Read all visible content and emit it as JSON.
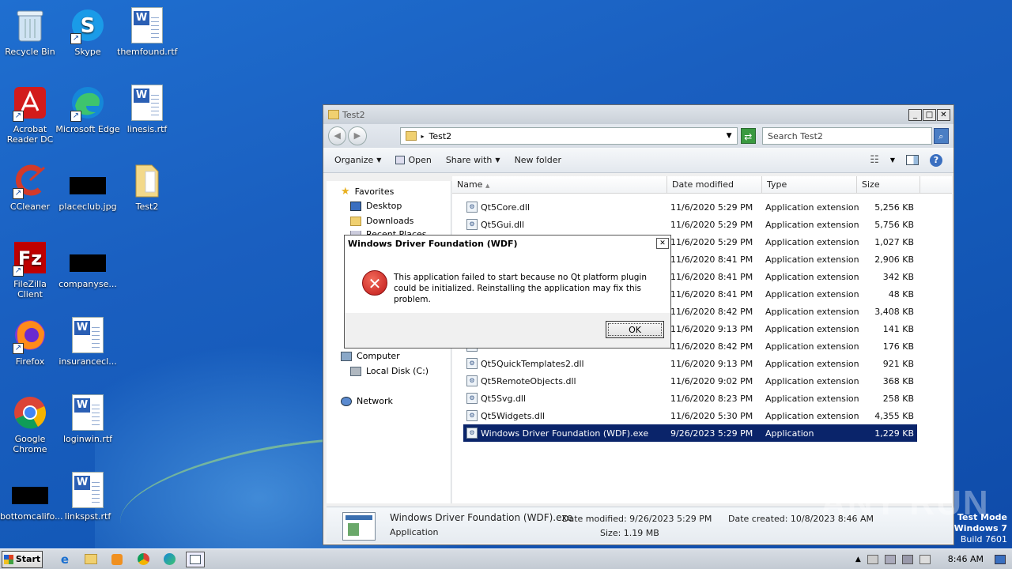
{
  "desktop": {
    "icons": [
      {
        "label": "Recycle Bin"
      },
      {
        "label": "Skype"
      },
      {
        "label": "themfound.rtf"
      },
      {
        "label": "Acrobat Reader DC"
      },
      {
        "label": "Microsoft Edge"
      },
      {
        "label": "linesis.rtf"
      },
      {
        "label": "CCleaner"
      },
      {
        "label": "placeclub.jpg"
      },
      {
        "label": "Test2"
      },
      {
        "label": "FileZilla Client"
      },
      {
        "label": "companyse..."
      },
      {
        "label": "Firefox"
      },
      {
        "label": "insurancecl..."
      },
      {
        "label": "Google Chrome"
      },
      {
        "label": "loginwin.rtf"
      },
      {
        "label": "bottomcalifo..."
      },
      {
        "label": "linkspst.rtf"
      }
    ]
  },
  "explorer": {
    "title": "Test2",
    "address": "Test2",
    "search_placeholder": "Search Test2",
    "commands": {
      "organize": "Organize",
      "open": "Open",
      "share_with": "Share with",
      "new_folder": "New folder"
    },
    "nav": {
      "favorites": "Favorites",
      "desktop": "Desktop",
      "downloads": "Downloads",
      "recent": "Recent Places",
      "computer": "Computer",
      "local_disk": "Local Disk (C:)",
      "network": "Network"
    },
    "columns": {
      "name": "Name",
      "date": "Date modified",
      "type": "Type",
      "size": "Size"
    },
    "files": [
      {
        "name": "Qt5Core.dll",
        "date": "11/6/2020 5:29 PM",
        "type": "Application extension",
        "size": "5,256 KB"
      },
      {
        "name": "Qt5Gui.dll",
        "date": "11/6/2020 5:29 PM",
        "type": "Application extension",
        "size": "5,756 KB"
      },
      {
        "name": "",
        "date": "11/6/2020 5:29 PM",
        "type": "Application extension",
        "size": "1,027 KB"
      },
      {
        "name": "",
        "date": "11/6/2020 8:41 PM",
        "type": "Application extension",
        "size": "2,906 KB"
      },
      {
        "name": "",
        "date": "11/6/2020 8:41 PM",
        "type": "Application extension",
        "size": "342 KB"
      },
      {
        "name": "",
        "date": "11/6/2020 8:41 PM",
        "type": "Application extension",
        "size": "48 KB"
      },
      {
        "name": "",
        "date": "11/6/2020 8:42 PM",
        "type": "Application extension",
        "size": "3,408 KB"
      },
      {
        "name": "",
        "date": "11/6/2020 9:13 PM",
        "type": "Application extension",
        "size": "141 KB"
      },
      {
        "name": "",
        "date": "11/6/2020 8:42 PM",
        "type": "Application extension",
        "size": "176 KB"
      },
      {
        "name": "Qt5QuickTemplates2.dll",
        "date": "11/6/2020 9:13 PM",
        "type": "Application extension",
        "size": "921 KB"
      },
      {
        "name": "Qt5RemoteObjects.dll",
        "date": "11/6/2020 9:02 PM",
        "type": "Application extension",
        "size": "368 KB"
      },
      {
        "name": "Qt5Svg.dll",
        "date": "11/6/2020 8:23 PM",
        "type": "Application extension",
        "size": "258 KB"
      },
      {
        "name": "Qt5Widgets.dll",
        "date": "11/6/2020 5:30 PM",
        "type": "Application extension",
        "size": "4,355 KB"
      },
      {
        "name": "Windows Driver Foundation (WDF).exe",
        "date": "9/26/2023 5:29 PM",
        "type": "Application",
        "size": "1,229 KB",
        "selected": true
      }
    ],
    "details": {
      "filename": "Windows Driver Foundation (WDF).exe",
      "kind": "Application",
      "date_modified": "Date modified: 9/26/2023 5:29 PM",
      "size": "Size: 1.19 MB",
      "date_created": "Date created: 10/8/2023 8:46 AM"
    }
  },
  "dialog": {
    "title": "Windows Driver Foundation (WDF)",
    "message": "This application failed to start because no Qt platform plugin could be initialized. Reinstalling the application may fix this problem.",
    "ok": "OK"
  },
  "watermark": "ANY RUN",
  "testmode": {
    "line1": "Test Mode",
    "line2": "Windows 7",
    "line3": "Build 7601"
  },
  "taskbar": {
    "start": "Start",
    "clock": "8:46 AM"
  }
}
